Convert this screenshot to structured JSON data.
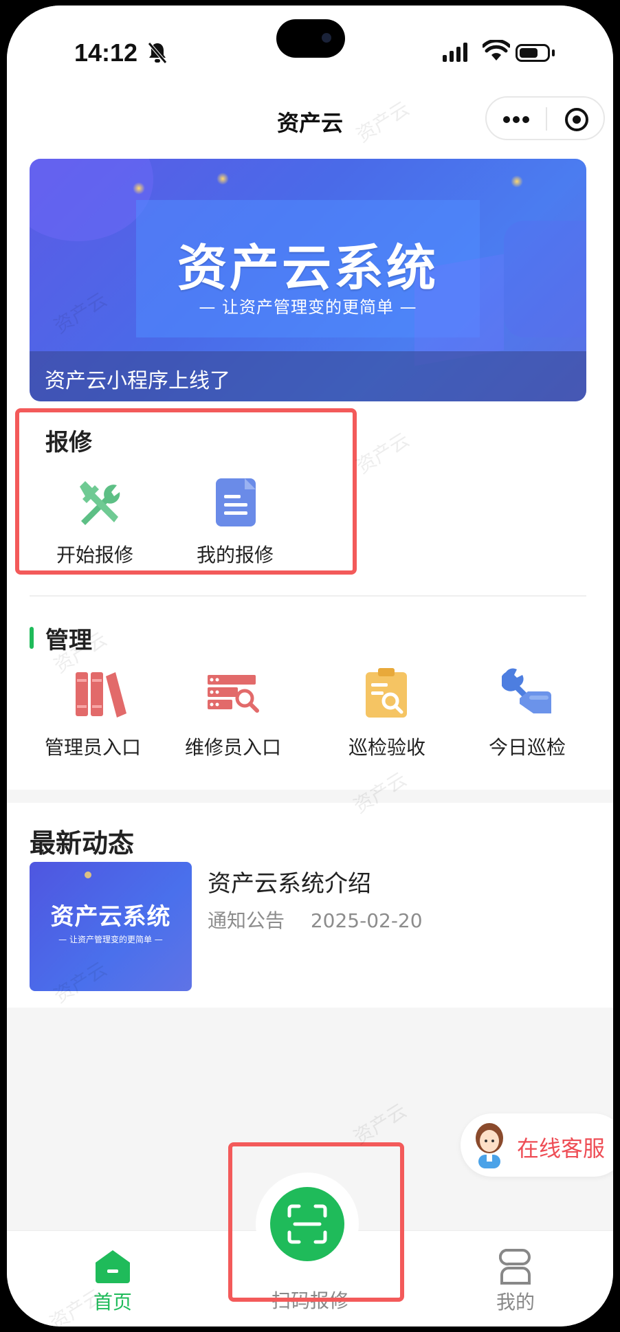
{
  "status_bar": {
    "time": "14:12"
  },
  "nav": {
    "title": "资产云"
  },
  "banner": {
    "title": "资产云系统",
    "subtitle": "— 让资产管理变的更简单 —",
    "caption": "资产云小程序上线了"
  },
  "repair": {
    "title": "报修",
    "items": [
      {
        "label": "开始报修",
        "icon": "wrench-screwdriver-icon"
      },
      {
        "label": "我的报修",
        "icon": "document-icon"
      }
    ]
  },
  "management": {
    "title": "管理",
    "items": [
      {
        "label": "管理员入口",
        "icon": "binders-icon"
      },
      {
        "label": "维修员入口",
        "icon": "server-search-icon"
      },
      {
        "label": "巡检验收",
        "icon": "clipboard-search-icon"
      },
      {
        "label": "今日巡检",
        "icon": "hand-wrench-icon"
      }
    ]
  },
  "news": {
    "title": "最新动态",
    "items": [
      {
        "thumb_title": "资产云系统",
        "thumb_subtitle": "— 让资产管理变的更简单 —",
        "title": "资产云系统介绍",
        "category": "通知公告",
        "date": "2025-02-20"
      }
    ]
  },
  "customer_service": {
    "label": "在线客服"
  },
  "tabbar": {
    "home": "首页",
    "scan": "扫码报修",
    "mine": "我的"
  },
  "watermark": "资产云",
  "colors": {
    "accent_green": "#1fbb5a",
    "highlight_red": "#f35a5a",
    "service_red": "#ee4d55",
    "banner_blue": "#4b7cf0"
  }
}
